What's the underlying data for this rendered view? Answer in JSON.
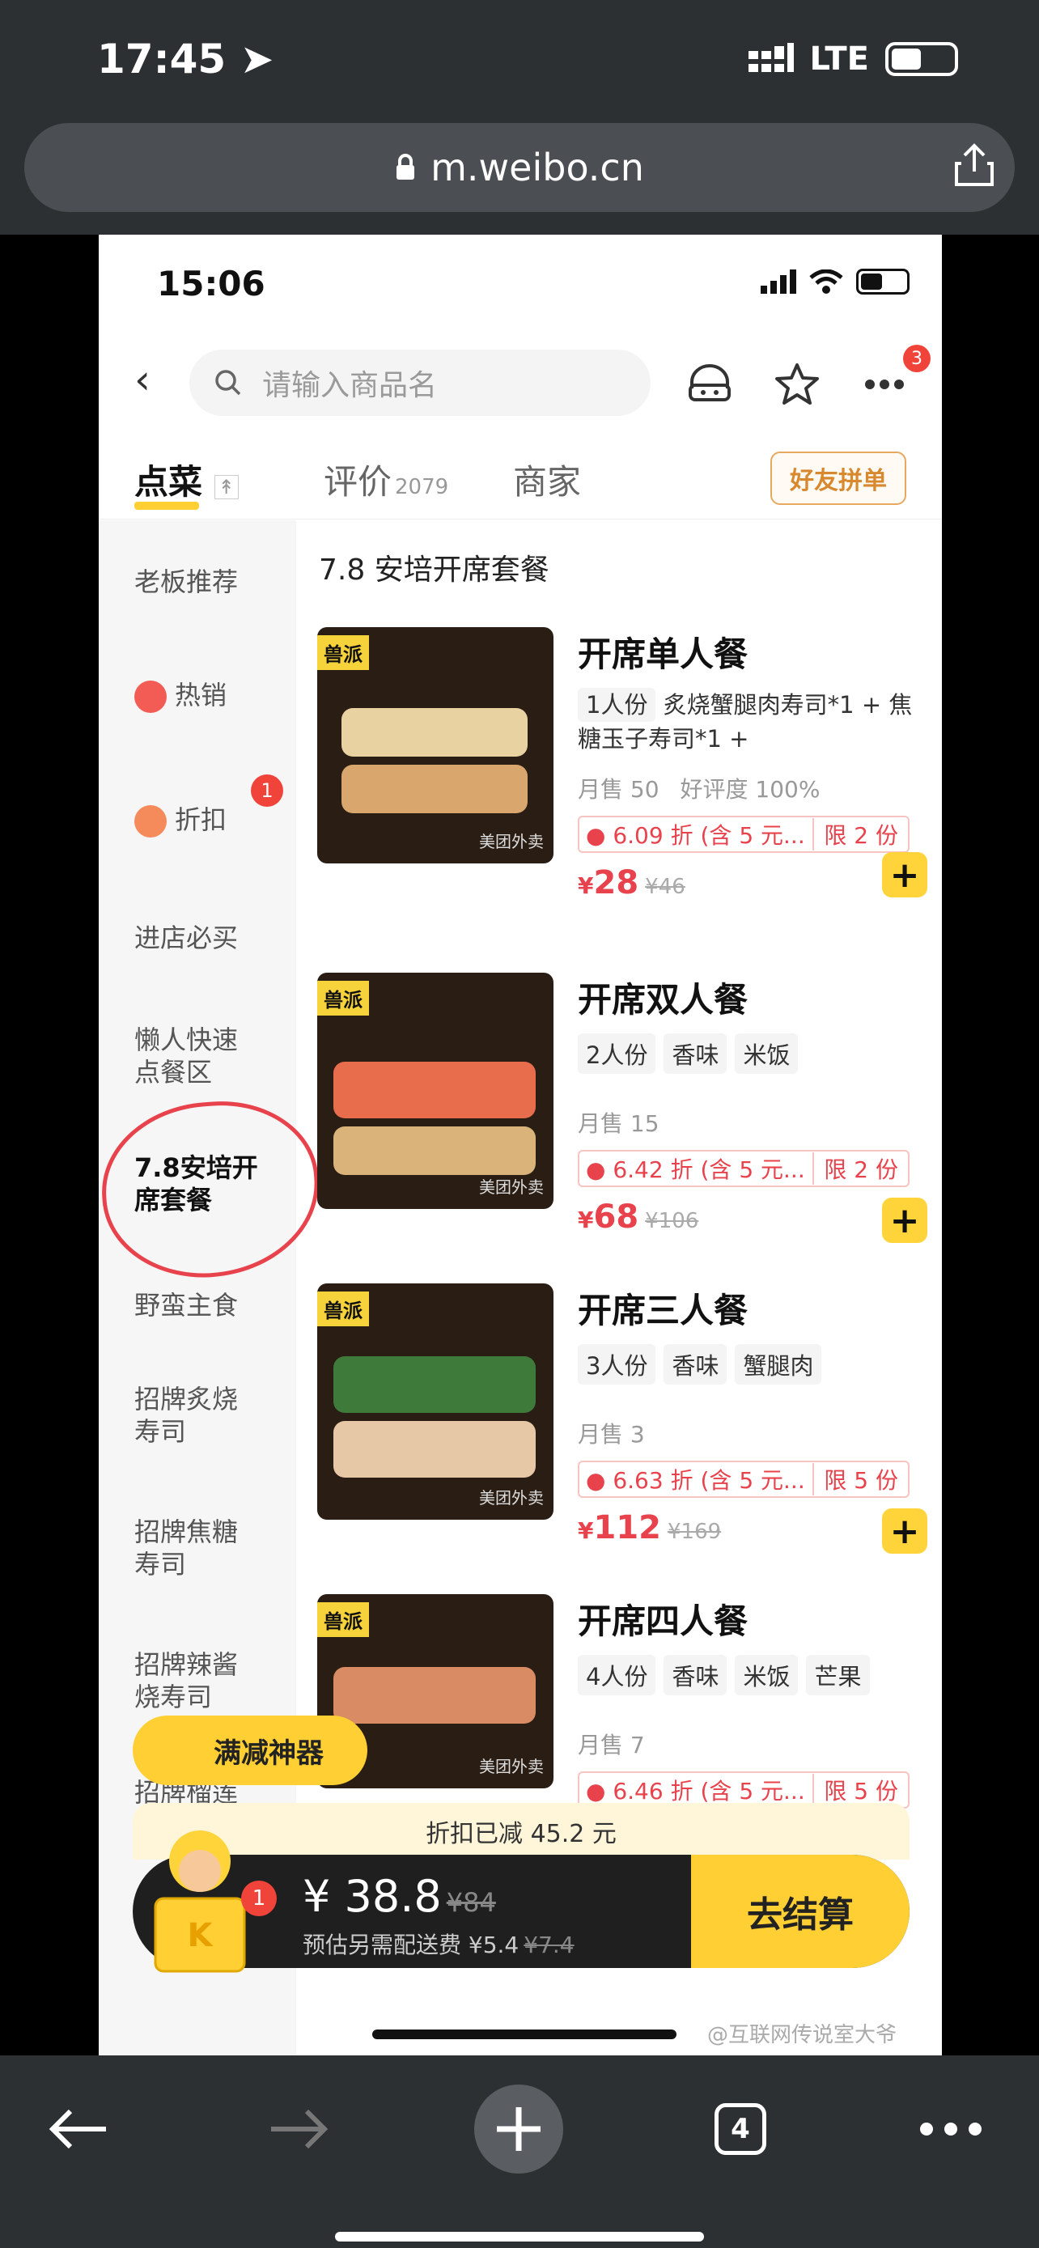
{
  "browser": {
    "time": "17:45",
    "network": "LTE",
    "url": "m.weibo.cn",
    "tab_count": "4"
  },
  "app": {
    "time": "15:06",
    "search_placeholder": "请输入商品名",
    "more_badge": "3",
    "tabs": [
      {
        "label": "点菜"
      },
      {
        "label": "评价",
        "count": "2079"
      },
      {
        "label": "商家"
      }
    ],
    "friend_button": "好友拼单"
  },
  "sidebar": {
    "items": [
      {
        "label": "老板推荐"
      },
      {
        "label": "热销"
      },
      {
        "label": "折扣",
        "badge": "1"
      },
      {
        "label": "进店必买"
      },
      {
        "label": "懒人快速点餐区"
      },
      {
        "label": "7.8安培开席套餐"
      },
      {
        "label": "野蛮主食"
      },
      {
        "label": "招牌炙烧寿司"
      },
      {
        "label": "招牌焦糖寿司"
      },
      {
        "label": "招牌辣酱烧寿司"
      },
      {
        "label": "招牌榴莲"
      }
    ]
  },
  "section_title": "7.8 安培开席套餐",
  "products": [
    {
      "name": "开席单人餐",
      "tags": [
        "1人份"
      ],
      "desc": "炙烧蟹腿肉寿司*1 + 焦糖玉子寿司*1 +",
      "sold": "月售 50",
      "rating": "好评度 100%",
      "discount": "6.09 折 (含 5 元...",
      "limit": "限 2 份",
      "price": "28",
      "old_price": "¥46"
    },
    {
      "name": "开席双人餐",
      "tags": [
        "2人份",
        "香味",
        "米饭"
      ],
      "sold": "月售 15",
      "discount": "6.42 折 (含 5 元...",
      "limit": "限 2 份",
      "price": "68",
      "old_price": "¥106"
    },
    {
      "name": "开席三人餐",
      "tags": [
        "3人份",
        "香味",
        "蟹腿肉"
      ],
      "sold": "月售 3",
      "discount": "6.63 折 (含 5 元...",
      "limit": "限 5 份",
      "price": "112",
      "old_price": "¥169"
    },
    {
      "name": "开席四人餐",
      "tags": [
        "4人份",
        "香味",
        "米饭",
        "芒果"
      ],
      "sold": "月售 7",
      "discount": "6.46 折 (含 5 元...",
      "limit": "限 5 份"
    }
  ],
  "thumb_text": {
    "brand": "兽派",
    "watermark": "美团外卖"
  },
  "promo": {
    "full_reduce": "满减神器",
    "discount_applied": "折扣已减 45.2 元"
  },
  "cart": {
    "badge": "1",
    "amount": "¥ 38.8",
    "old_amount": "¥84",
    "delivery": "预估另需配送费 ¥5.4",
    "old_delivery": "¥7.4",
    "checkout": "去结算"
  },
  "watermark": "@互联网传说室大爷",
  "colors": {
    "accent_yellow": "#ffcf33",
    "price_red": "#e8434c",
    "circle_red": "#e8434c"
  }
}
